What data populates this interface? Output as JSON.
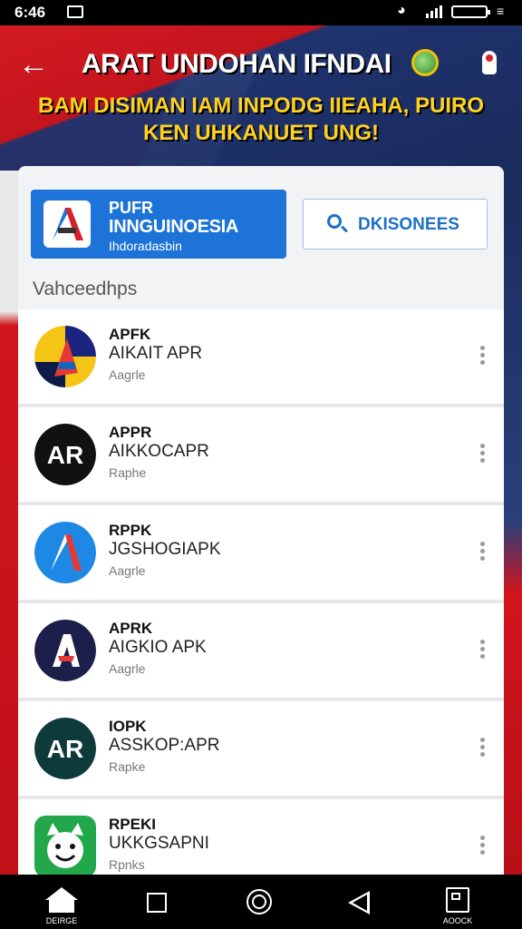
{
  "status_bar": {
    "time": "6:46"
  },
  "header": {
    "title": "ARAT UNDOHAN IFNDAI",
    "subtitle_line1": "BAM DISIMAN IAM INPODG IIEAHA, PUIRO",
    "subtitle_line2": "KEN UHKANUET UNG!"
  },
  "featured": {
    "line1": "PUFR",
    "line2": "INNGUINOESIA",
    "line3": "Ihdoradasbin"
  },
  "search_button": {
    "label": "DKISONEES"
  },
  "section_title": "Vahceedhps",
  "apps": [
    {
      "name": "APFK",
      "subtitle": "AIKAIT APR",
      "meta": "Aagrle"
    },
    {
      "name": "APPR",
      "subtitle": "AIKKOCAPR",
      "meta": "Raphe"
    },
    {
      "name": "RPPK",
      "subtitle": "JGSHOGIAPK",
      "meta": "Aagrle"
    },
    {
      "name": "APRK",
      "subtitle": "AIGKIO APK",
      "meta": "Aagrle"
    },
    {
      "name": "IOPK",
      "subtitle": "ASSKOP:APR",
      "meta": "Rapke"
    },
    {
      "name": "RPEKI",
      "subtitle": "UKKGSAPNI",
      "meta": "Rpnks"
    }
  ],
  "nav": {
    "home_label": "DEIRGE",
    "doc_label": "AOOCK"
  },
  "colors": {
    "accent_blue": "#1d73d8",
    "flag_red": "#d41a22",
    "title_yellow": "#ffd21f"
  }
}
